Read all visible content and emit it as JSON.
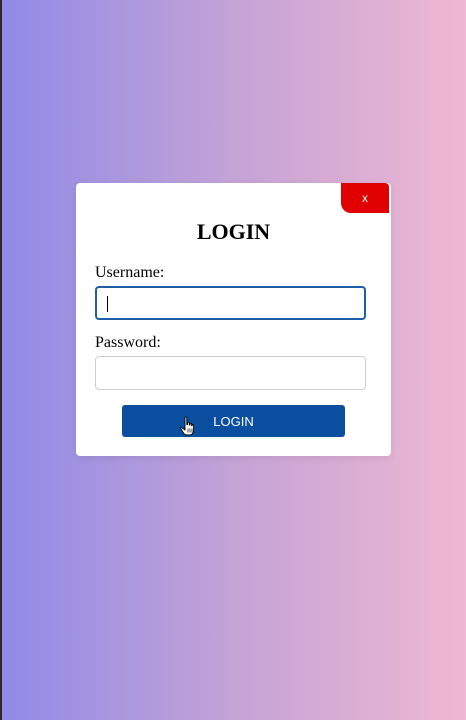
{
  "modal": {
    "close_label": "x",
    "title": "LOGIN",
    "username_label": "Username:",
    "username_value": "",
    "password_label": "Password:",
    "password_value": "",
    "login_label": "LOGIN"
  },
  "colors": {
    "gradient_left": "#8f8ae6",
    "gradient_right": "#efb8d2",
    "close_button": "#e00000",
    "login_button": "#0a4ea0",
    "focused_border": "#1f5fa7"
  },
  "icons": {
    "cursor": "hand-pointer-icon"
  }
}
